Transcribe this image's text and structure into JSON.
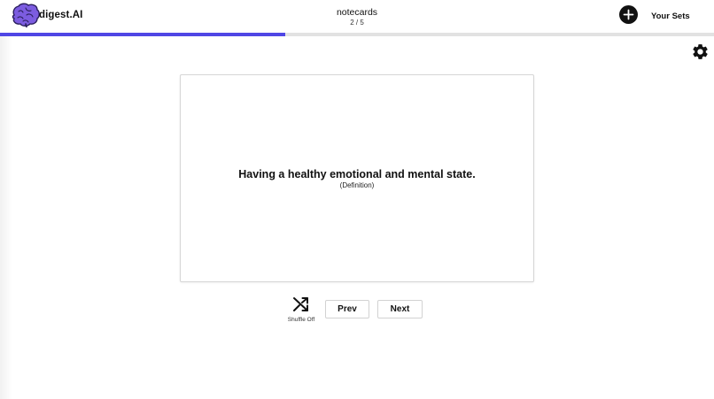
{
  "header": {
    "logo_text": "digest.AI",
    "set_title": "notecards",
    "counter": "2 / 5",
    "add_icon": "plus-icon",
    "your_sets_label": "Your Sets"
  },
  "progress": {
    "current": 2,
    "total": 5,
    "fraction": 0.4,
    "color": "#4f46e5"
  },
  "settings": {
    "icon": "gear-icon"
  },
  "card": {
    "text": "Having a healthy emotional and mental state.",
    "side": "(Definition)"
  },
  "controls": {
    "shuffle_icon": "shuffle-icon",
    "shuffle_label": "Shuffle Off",
    "prev_label": "Prev",
    "next_label": "Next"
  },
  "colors": {
    "accent": "#4f46e5",
    "brain": "#7c5ce0"
  }
}
